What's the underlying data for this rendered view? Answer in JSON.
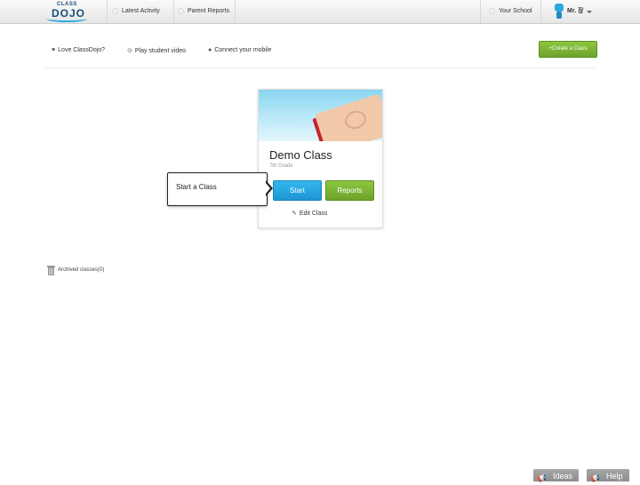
{
  "topbar": {
    "logo_small": "CLASS",
    "logo_big": "DOJO",
    "nav": [
      {
        "label": "Latest Activity"
      },
      {
        "label": "Parent Reports"
      }
    ],
    "your_school": "Your School",
    "user_name": "Mr. 장"
  },
  "subbar": {
    "love": "Love ClassDojo?",
    "video": "Play student video",
    "mobile": "Connect your mobile",
    "create_class": "+Create a Class"
  },
  "card": {
    "class_name": "Demo Class",
    "grade": "7th Grade",
    "start": "Start",
    "reports": "Reports",
    "edit": "Edit Class"
  },
  "tooltip": {
    "text": "Start a Class"
  },
  "archived": {
    "label": "Archived classes(0)"
  },
  "bottom": {
    "ideas": "Ideas",
    "help": "Help"
  },
  "colors": {
    "accent_blue": "#29abe2",
    "accent_green": "#7cb733"
  }
}
